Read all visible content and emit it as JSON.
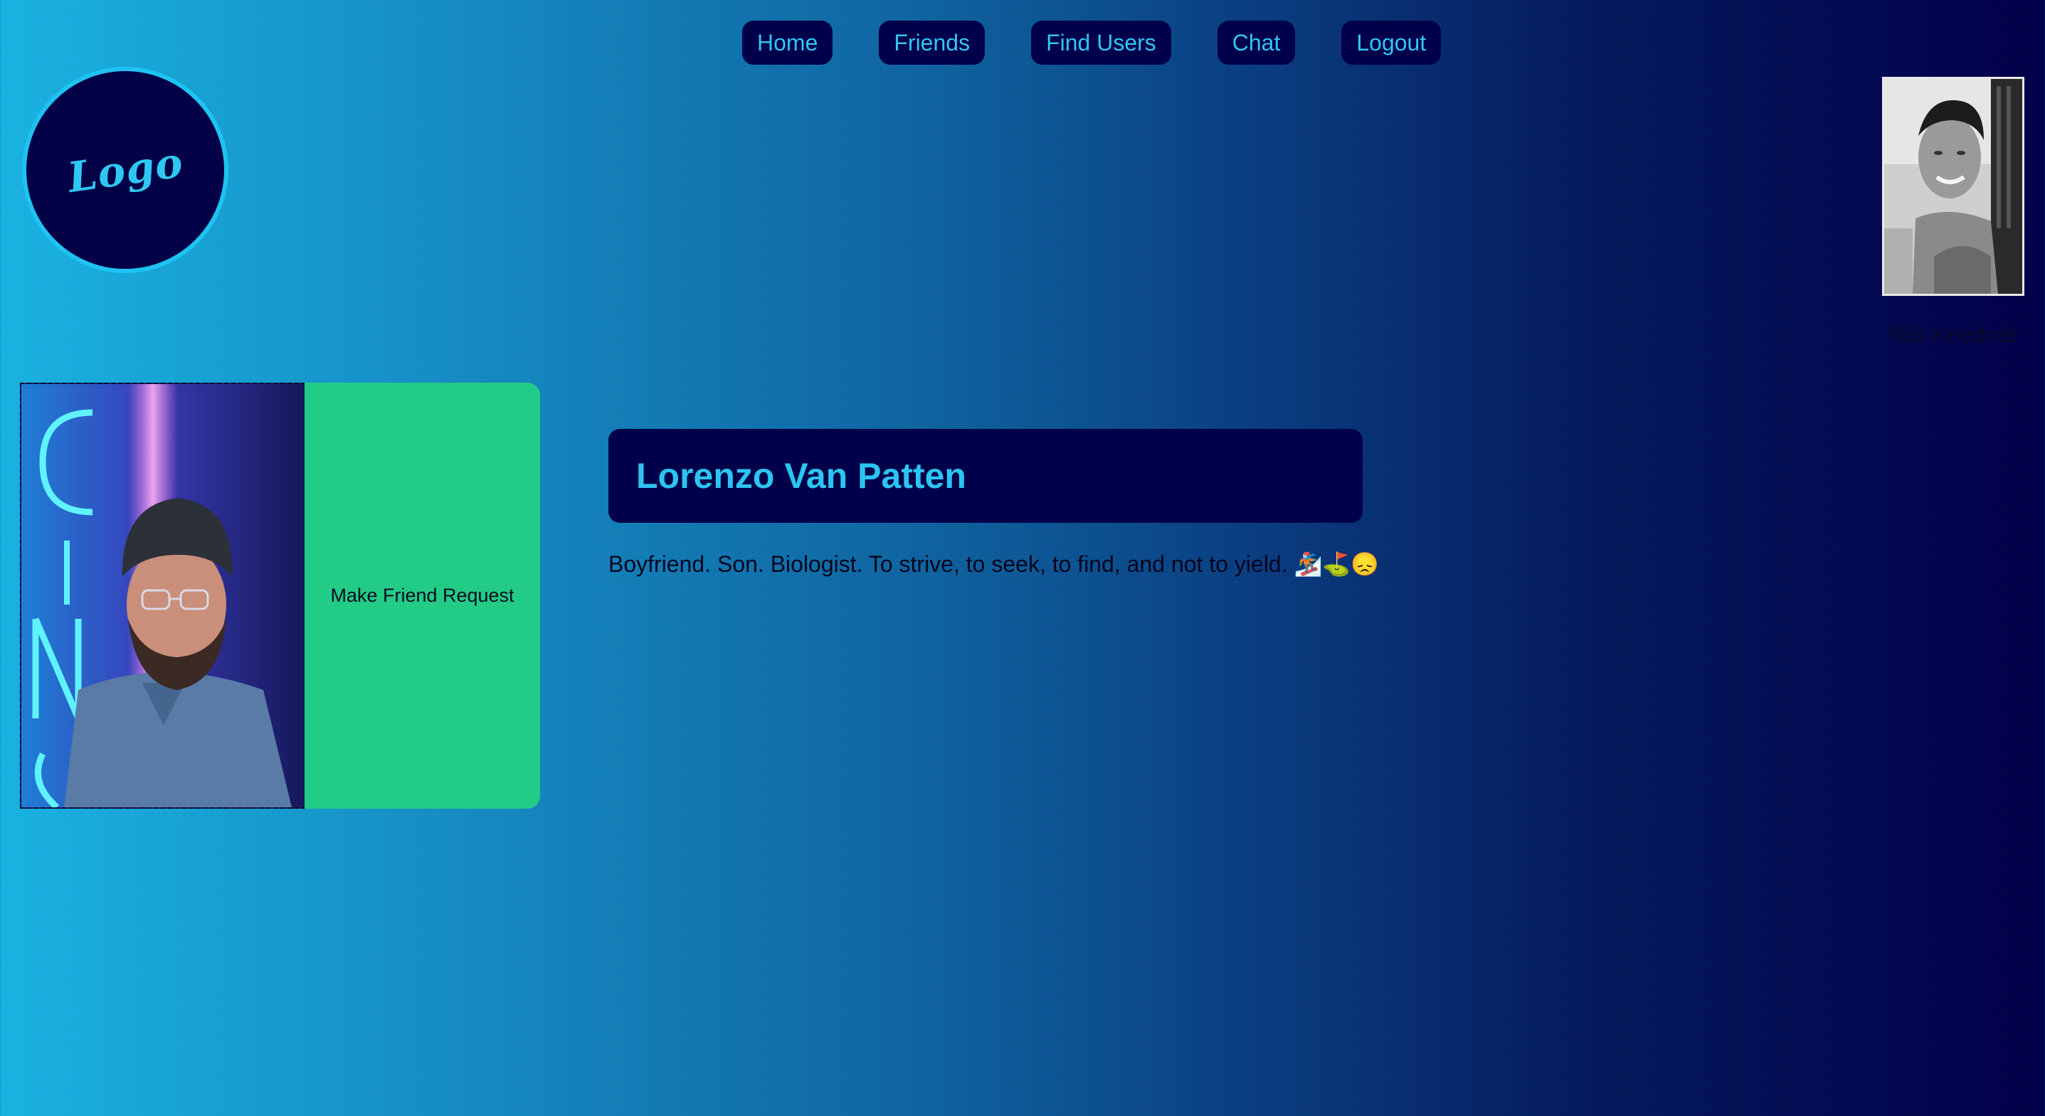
{
  "nav": {
    "items": [
      {
        "label": "Home"
      },
      {
        "label": "Friends"
      },
      {
        "label": "Find Users"
      },
      {
        "label": "Chat"
      },
      {
        "label": "Logout"
      }
    ]
  },
  "logo": {
    "text": "Logo"
  },
  "current_user": {
    "name": "Nils Kriedner"
  },
  "profile": {
    "name": "Lorenzo Van Patten",
    "bio": "Boyfriend. Son. Biologist. To strive, to seek, to find, and not to yield. 🏂⛳😞",
    "friend_button_label": "Make Friend Request"
  },
  "colors": {
    "nav_button_bg": "#00004a",
    "nav_button_text": "#31c6f0",
    "friend_button_bg": "#23cc86",
    "name_box_bg": "#00004a",
    "name_text": "#2cc4f1",
    "gradient_start": "#1ab2e0",
    "gradient_end": "#02004a"
  }
}
